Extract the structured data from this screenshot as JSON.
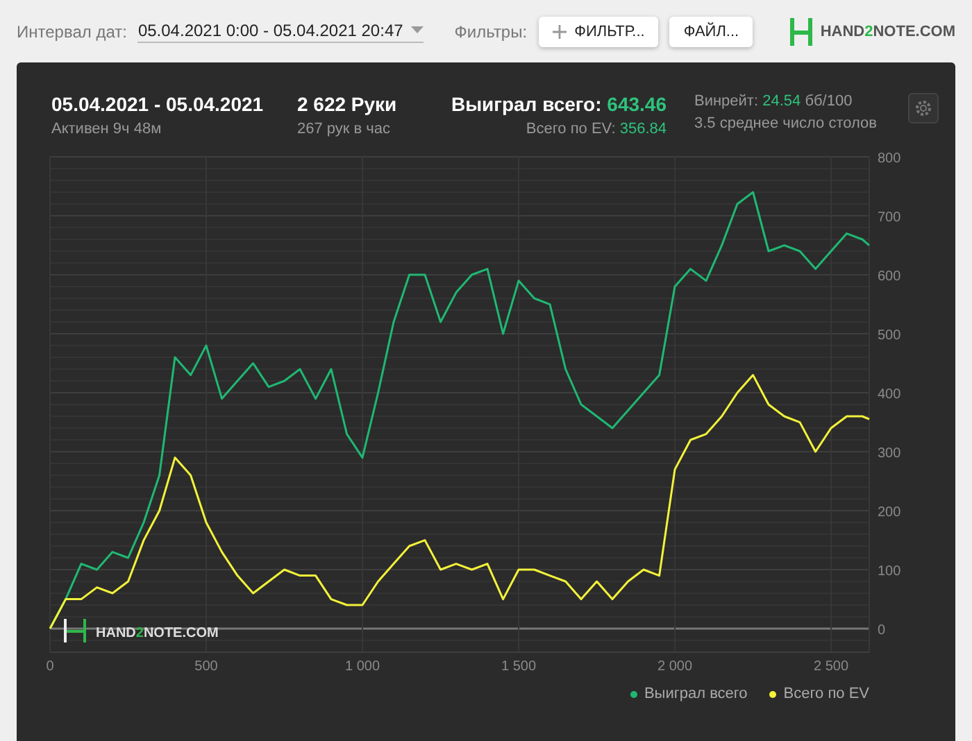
{
  "toolbar": {
    "date_label": "Интервал дат:",
    "date_value": "05.04.2021 0:00 - 05.04.2021 20:47",
    "filters_label": "Фильтры:",
    "buttons": [
      {
        "label": "ФИЛЬТР...",
        "kind": "add"
      },
      {
        "label": "ФАЙЛ...",
        "kind": "plain"
      }
    ],
    "logo": {
      "prefix": "HAND",
      "accent": "2",
      "suffix": "NOTE.COM"
    }
  },
  "summary": {
    "period": "05.04.2021 - 05.04.2021",
    "active": "Активен 9ч 48м",
    "hands": "2 622 Руки",
    "hands_rate": "267 рук в час",
    "won_label": "Выиграл всего:",
    "won_value": "643.46",
    "ev_label": "Всего по EV:",
    "ev_value": "356.84",
    "winrate_label": "Винрейт:",
    "winrate_value": "24.54",
    "winrate_unit": "бб/100",
    "tables": "3.5 среднее число столов"
  },
  "chart": {
    "watermark": {
      "prefix": "HAND",
      "accent": "2",
      "suffix": "NOTE.COM"
    },
    "chart_data": {
      "type": "line",
      "x": [
        0,
        50,
        100,
        150,
        200,
        250,
        300,
        350,
        400,
        450,
        500,
        550,
        600,
        650,
        700,
        750,
        800,
        850,
        900,
        950,
        1000,
        1050,
        1100,
        1150,
        1200,
        1250,
        1300,
        1350,
        1400,
        1450,
        1500,
        1550,
        1600,
        1650,
        1700,
        1750,
        1800,
        1850,
        1900,
        1950,
        2000,
        2050,
        2100,
        2150,
        2200,
        2250,
        2300,
        2350,
        2400,
        2450,
        2500,
        2550,
        2600,
        2622
      ],
      "series": [
        {
          "name": "Выиграл всего",
          "color": "#1fb873",
          "values": [
            0,
            50,
            110,
            100,
            130,
            120,
            180,
            260,
            460,
            430,
            480,
            390,
            420,
            450,
            410,
            420,
            440,
            390,
            440,
            330,
            290,
            400,
            520,
            600,
            600,
            520,
            570,
            600,
            610,
            500,
            590,
            560,
            550,
            440,
            380,
            360,
            340,
            370,
            400,
            430,
            580,
            610,
            590,
            650,
            720,
            740,
            640,
            650,
            640,
            610,
            640,
            670,
            660,
            650
          ]
        },
        {
          "name": "Всего по EV",
          "color": "#f2f23a",
          "values": [
            0,
            50,
            50,
            70,
            60,
            80,
            150,
            200,
            290,
            260,
            180,
            130,
            90,
            60,
            80,
            100,
            90,
            90,
            50,
            40,
            40,
            80,
            110,
            140,
            150,
            100,
            110,
            100,
            110,
            50,
            100,
            100,
            90,
            80,
            50,
            80,
            50,
            80,
            100,
            90,
            270,
            320,
            330,
            360,
            400,
            430,
            380,
            360,
            350,
            300,
            340,
            360,
            360,
            355
          ]
        }
      ],
      "xlim": [
        0,
        2622
      ],
      "ylim": [
        -40,
        800
      ],
      "grid": true,
      "xticks": [
        0,
        {
          "value": 500,
          "label": "500"
        },
        {
          "value": 1000,
          "label": "1 000"
        },
        {
          "value": 1500,
          "label": "1 500"
        },
        {
          "value": 2000,
          "label": "2 000"
        },
        {
          "value": 2500,
          "label": "2 500"
        }
      ],
      "yticks": [
        0,
        100,
        200,
        300,
        400,
        500,
        600,
        700,
        800
      ]
    }
  }
}
